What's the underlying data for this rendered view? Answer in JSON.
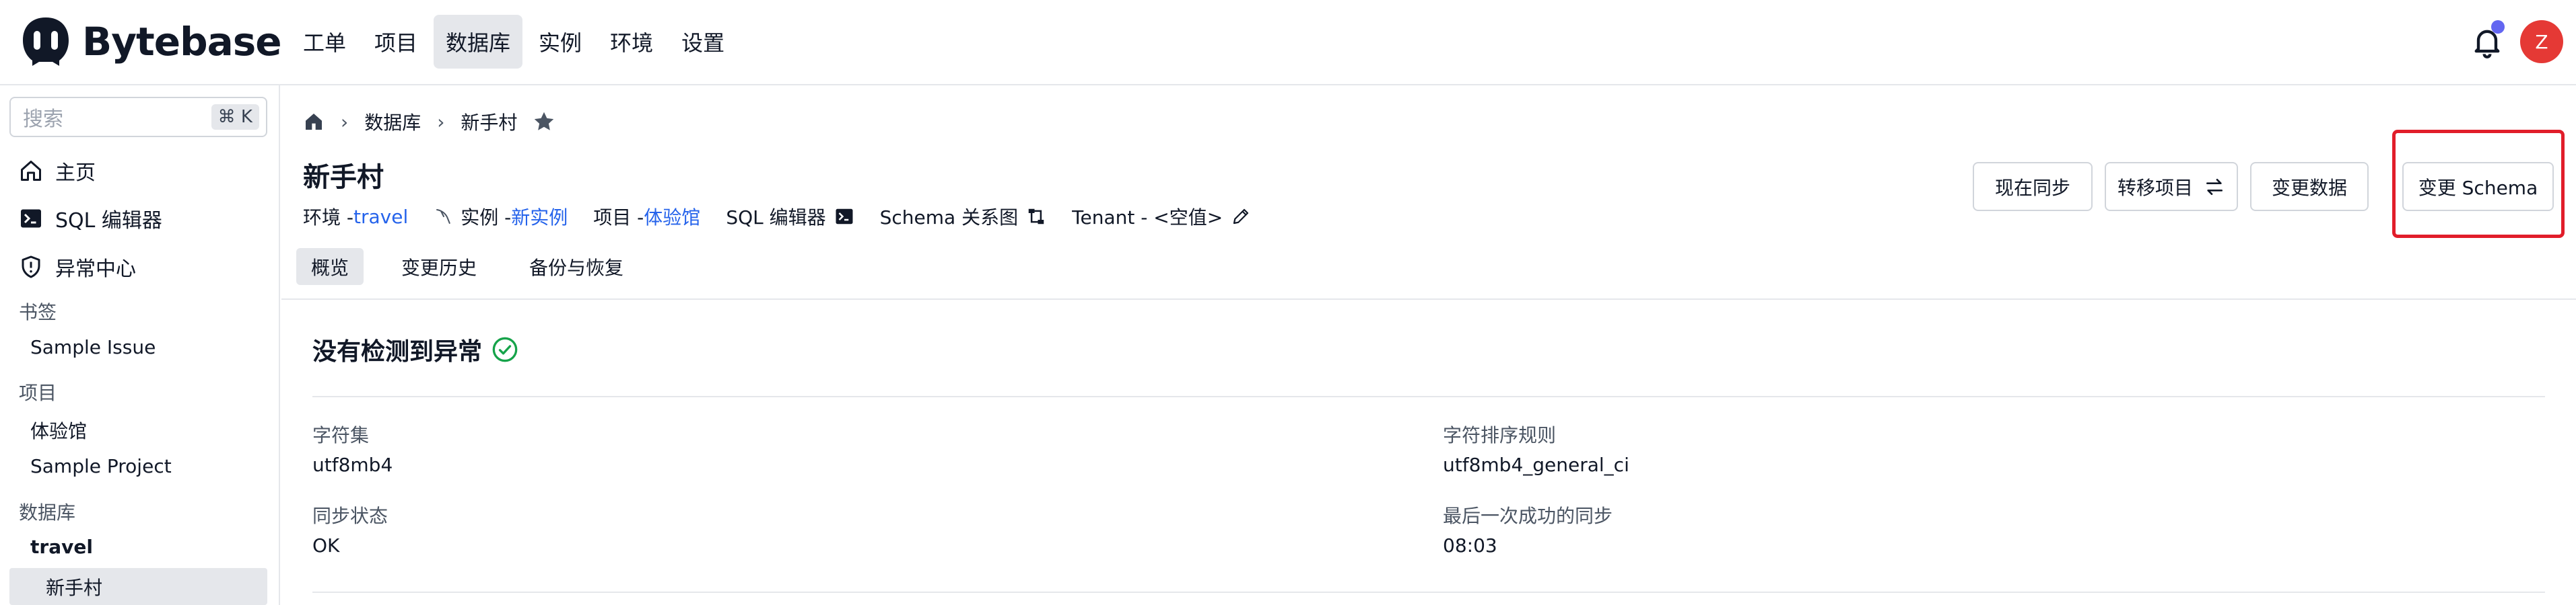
{
  "app": {
    "name": "Bytebase",
    "brand_color": "#111827"
  },
  "topnav": [
    {
      "label": "工单",
      "active": false
    },
    {
      "label": "项目",
      "active": false
    },
    {
      "label": "数据库",
      "active": true
    },
    {
      "label": "实例",
      "active": false
    },
    {
      "label": "环境",
      "active": false
    },
    {
      "label": "设置",
      "active": false
    }
  ],
  "user": {
    "avatar_letter": "Z",
    "avatar_color": "#e53935",
    "notification_dot_color": "#6366f1"
  },
  "sidebar": {
    "search_placeholder": "搜索",
    "search_shortcut": "⌘ K",
    "items": [
      {
        "label": "主页",
        "icon": "home-icon"
      },
      {
        "label": "SQL 编辑器",
        "icon": "terminal-icon"
      },
      {
        "label": "异常中心",
        "icon": "shield-icon"
      }
    ],
    "bookmarks_title": "书签",
    "bookmarks": [
      "Sample Issue"
    ],
    "projects_title": "项目",
    "projects": [
      "体验馆",
      "Sample Project"
    ],
    "databases_title": "数据库",
    "db_env": "travel",
    "db_active": "新手村"
  },
  "breadcrumb": {
    "section": "数据库",
    "current": "新手村"
  },
  "page": {
    "title": "新手村",
    "env_label": "环境 - ",
    "env_value": "travel",
    "instance_label": "实例 - ",
    "instance_value": "新实例",
    "project_label": "项目 - ",
    "project_value": "体验馆",
    "sql_editor": "SQL 编辑器",
    "schema_diagram": "Schema 关系图",
    "tenant": "Tenant - <空值>"
  },
  "actions": {
    "sync_now": "现在同步",
    "transfer_project": "转移项目",
    "change_data": "变更数据",
    "change_schema": "变更 Schema",
    "highlight_color": "#e11d2a"
  },
  "tabs": [
    {
      "label": "概览",
      "active": true
    },
    {
      "label": "变更历史",
      "active": false
    },
    {
      "label": "备份与恢复",
      "active": false
    }
  ],
  "overview": {
    "anomaly_title": "没有检测到异常",
    "anomaly_ok_color": "#16a34a",
    "charset_label": "字符集",
    "charset_value": "utf8mb4",
    "collation_label": "字符排序规则",
    "collation_value": "utf8mb4_general_ci",
    "sync_status_label": "同步状态",
    "sync_status_value": "OK",
    "last_sync_label": "最后一次成功的同步",
    "last_sync_value": "08:03"
  }
}
